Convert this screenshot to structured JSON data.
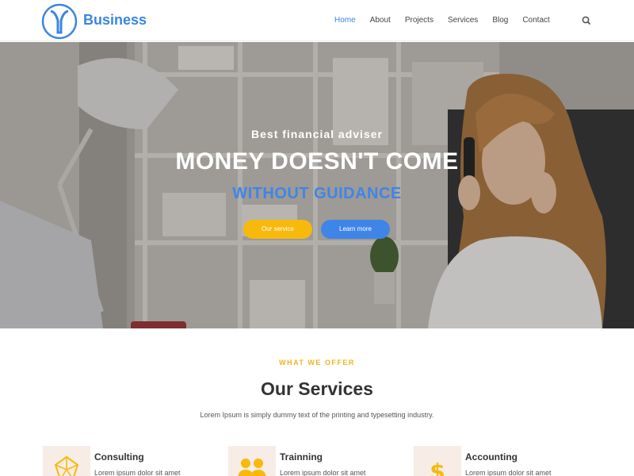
{
  "header": {
    "brand": "Business",
    "nav": [
      "Home",
      "About",
      "Projects",
      "Services",
      "Blog",
      "Contact"
    ],
    "active_nav": "Home",
    "accent_color": "#3a86e0"
  },
  "hero": {
    "subtitle": "Best financial adviser",
    "title": "MONEY DOESN'T COME",
    "title_highlight": "WITHOUT GUIDANCE",
    "primary_button": "Our service",
    "secondary_button": "Learn more",
    "primary_color": "#f7b90c",
    "secondary_color": "#3f85e8"
  },
  "services": {
    "label": "WHAT WE OFFER",
    "title": "Our Services",
    "description": "Lorem Ipsum is simply dummy text of the printing and typesetting industry.",
    "items": [
      {
        "name": "Consulting",
        "text": "Lorem ipsum dolor sit amet",
        "icon": "diamond-icon"
      },
      {
        "name": "Trainning",
        "text": "Lorem ipsum dolor sit amet",
        "icon": "people-icon"
      },
      {
        "name": "Accounting",
        "text": "Lorem ipsum dolor sit amet",
        "icon": "dollar-icon"
      }
    ]
  }
}
